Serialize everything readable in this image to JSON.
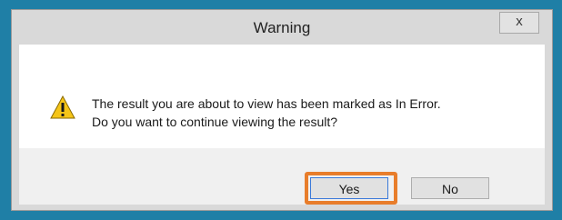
{
  "dialog": {
    "title": "Warning",
    "close_glyph": "x",
    "icon": "warning-triangle-icon",
    "message_line1": "The result you are about to view has been marked as In Error.",
    "message_line2": "Do you want to continue viewing the result?"
  },
  "buttons": {
    "yes_label": "Yes",
    "no_label": "No"
  },
  "colors": {
    "frame": "#1f7fa6",
    "highlight": "#e87d2b",
    "warning_fill": "#f5c518"
  }
}
